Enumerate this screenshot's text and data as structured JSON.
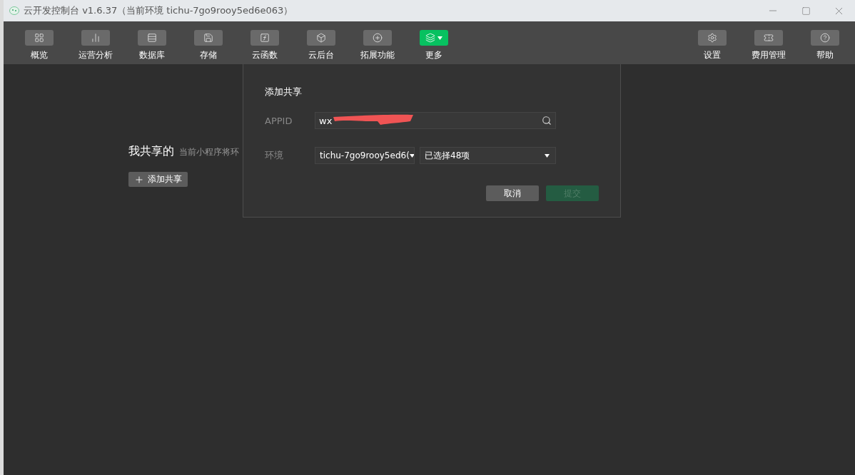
{
  "window": {
    "title": "云开发控制台 v1.6.37（当前环境 tichu-7go9rooy5ed6e063）"
  },
  "toolbar": {
    "left": [
      {
        "label": "概览",
        "selected": false
      },
      {
        "label": "运营分析",
        "selected": false
      },
      {
        "label": "数据库",
        "selected": false
      },
      {
        "label": "存储",
        "selected": false
      },
      {
        "label": "云函数",
        "selected": false
      },
      {
        "label": "云后台",
        "selected": false
      },
      {
        "label": "拓展功能",
        "selected": false
      },
      {
        "label": "更多",
        "selected": true
      }
    ],
    "right": [
      {
        "label": "设置",
        "selected": false
      },
      {
        "label": "费用管理",
        "selected": false
      },
      {
        "label": "帮助",
        "selected": false
      }
    ]
  },
  "page": {
    "title": "我共享的",
    "subtitle": "当前小程序将环",
    "add_button": "添加共享"
  },
  "dialog": {
    "title": "添加共享",
    "appid_label": "APPID",
    "appid_value": "wx",
    "env_label": "环境",
    "env_select": "tichu-7go9rooy5ed6(",
    "resource_select": "已选择48项",
    "cancel": "取消",
    "submit": "提交",
    "submit_disabled": true
  }
}
